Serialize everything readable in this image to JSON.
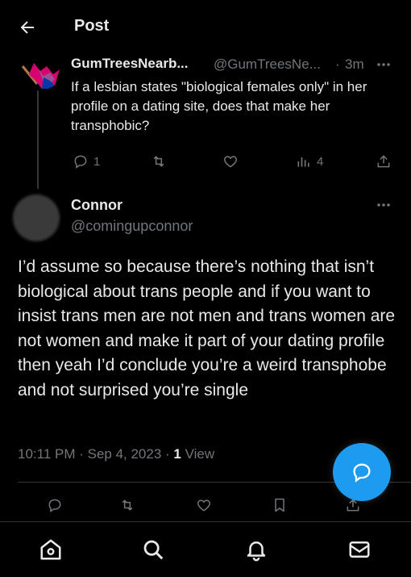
{
  "header": {
    "title": "Post",
    "back_icon": "arrow-left-icon"
  },
  "parent_post": {
    "display_name": "GumTreesNearb...",
    "handle": "@GumTreesNe...",
    "separator": "·",
    "time": "3m",
    "text": "If a lesbian states \"biological females only\" in her profile on a dating site, does that make her transphobic?",
    "replies": "1",
    "views": "4",
    "avatar_icon": "flag-icon"
  },
  "main_post": {
    "display_name": "Connor",
    "handle": "@comingupconnor",
    "text": "I’d assume so because there’s nothing that isn’t biological about trans people and if you want to insist trans men are not men and trans women are not women and make it part of your dating profile then yeah I’d conclude you’re a weird transphobe and not surprised you’re single",
    "timestamp": "10:11 PM · Sep 4, 2023 · ",
    "view_count": "1",
    "view_label": " View"
  },
  "colors": {
    "accent": "#1d9bf0",
    "muted": "#71767b",
    "text": "#e7e9ea",
    "background": "#000000"
  },
  "nav": [
    "home-icon",
    "search-icon",
    "notifications-icon",
    "messages-icon"
  ]
}
